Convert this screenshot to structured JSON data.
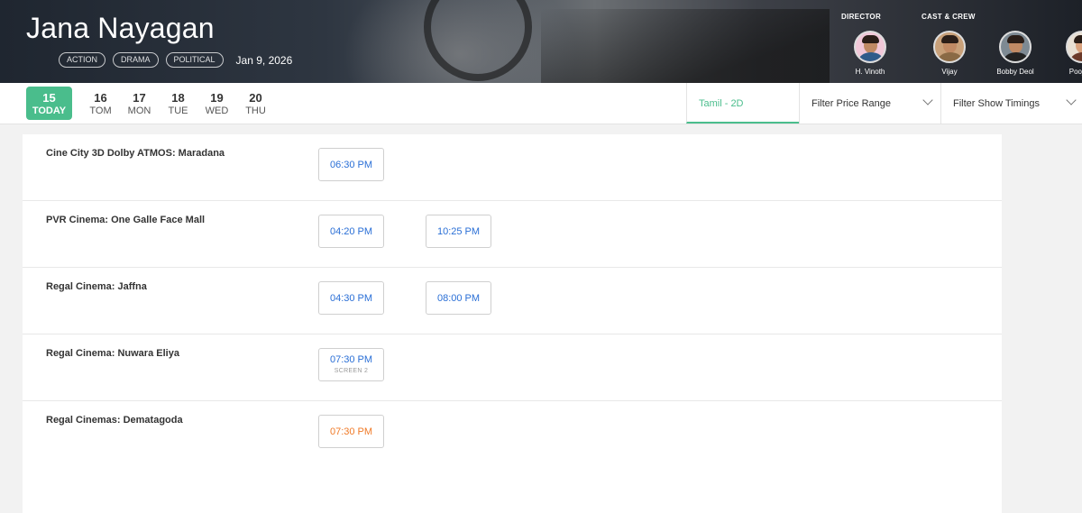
{
  "movie": {
    "title": "Jana Nayagan",
    "tags": [
      "ACTION",
      "DRAMA",
      "POLITICAL"
    ],
    "release_date": "Jan 9, 2026"
  },
  "crew": {
    "director_heading": "DIRECTOR",
    "cast_heading": "CAST & CREW",
    "people": [
      {
        "name": "H. Vinoth"
      },
      {
        "name": "Vijay"
      },
      {
        "name": "Bobby Deol"
      },
      {
        "name": "Pooja H"
      }
    ]
  },
  "dates": [
    {
      "num": "15",
      "day": "TODAY",
      "selected": true
    },
    {
      "num": "16",
      "day": "TOM"
    },
    {
      "num": "17",
      "day": "MON"
    },
    {
      "num": "18",
      "day": "TUE"
    },
    {
      "num": "19",
      "day": "WED"
    },
    {
      "num": "20",
      "day": "THU"
    }
  ],
  "filters": {
    "language": "Tamil - 2D",
    "price": "Filter Price Range",
    "timings": "Filter Show Timings"
  },
  "colors": {
    "accent": "#4abd8c",
    "time_link": "#2a6fd6",
    "time_filling_fast": "#f07a27"
  },
  "cinemas": [
    {
      "name": "Cine City 3D Dolby ATMOS: Maradana",
      "shows": [
        {
          "time": "06:30 PM"
        }
      ]
    },
    {
      "name": "PVR Cinema: One Galle Face Mall",
      "shows": [
        {
          "time": "04:20 PM"
        },
        {
          "time": "10:25 PM"
        }
      ]
    },
    {
      "name": "Regal Cinema: Jaffna",
      "shows": [
        {
          "time": "04:30 PM"
        },
        {
          "time": "08:00 PM"
        }
      ]
    },
    {
      "name": "Regal Cinema: Nuwara Eliya",
      "shows": [
        {
          "time": "07:30 PM",
          "screen": "SCREEN 2"
        }
      ]
    },
    {
      "name": "Regal Cinemas: Dematagoda",
      "shows": [
        {
          "time": "07:30 PM",
          "status": "filling-fast"
        }
      ]
    }
  ]
}
